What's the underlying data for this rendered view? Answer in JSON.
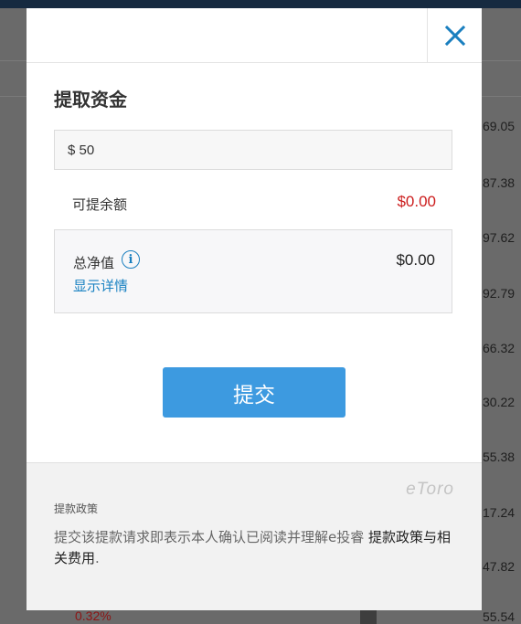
{
  "background": {
    "side_values": [
      "69.05",
      "87.38",
      "97.62",
      "92.79",
      "66.32",
      "30.22",
      "55.38",
      "17.24",
      "47.82",
      "55.54"
    ],
    "bottom_percent": "0.32%"
  },
  "dialog": {
    "title": "提取资金",
    "amount": {
      "value": "$ 50",
      "placeholder": ""
    },
    "available": {
      "label": "可提余额",
      "value": "$0.00",
      "color": "#cc1d1d"
    },
    "equity": {
      "label": "总净值",
      "value": "$0.00",
      "details_link": "显示详情",
      "info_icon": "info-icon"
    },
    "submit_label": "提交",
    "close_icon": "close-icon"
  },
  "footer": {
    "logo_text": "eToro",
    "policy_heading": "提款政策",
    "policy_text_prefix": "提交该提款请求即表示本人确认已阅读并理解e投睿",
    "policy_link": "提款政策与相关费用",
    "policy_text_suffix": "."
  },
  "colors": {
    "accent": "#3d9ae0",
    "link": "#1a82c2",
    "negative": "#cc1d1d"
  }
}
